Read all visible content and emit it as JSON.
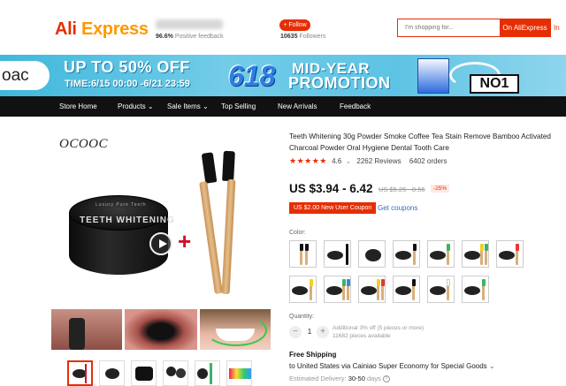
{
  "header": {
    "logo": "AliExpress",
    "feedback_value": "96.6%",
    "feedback_label": "Positive feedback",
    "follow_label": "+ Follow",
    "followers_value": "10635",
    "followers_label": "Followers",
    "search_placeholder": "I'm shopping for...",
    "search_button": "On AliExpress",
    "search_button2": "In"
  },
  "banner": {
    "brand": "oac",
    "headline": "UP TO 50% OFF",
    "time": "TIME:6/15 00:00 -6/21 23:59",
    "big_number": "618",
    "line1": "MID-YEAR",
    "line2": "PROMOTION",
    "badge": "NO1",
    "colors": {
      "background": "#5ec3e4",
      "number": "#2f7fe0"
    }
  },
  "nav": {
    "items": [
      "Store Home",
      "Products",
      "Sale Items",
      "Top Selling",
      "New Arrivals",
      "Feedback"
    ],
    "dropdown_icon": "chevron-down-icon"
  },
  "gallery": {
    "brand_text": "OCOOC",
    "jar_text_1": "Luxury Pure Teeth",
    "jar_text_2": "TEETH WHITENING",
    "plus_sign": "+",
    "play_icon": "play-icon"
  },
  "product": {
    "title": "Teeth Whitening 30g Powder Smoke Coffee Tea Stain Remove Bamboo Activated Charcoal Powder Oral Hygiene Dental Tooth Care",
    "stars": "★★★★★",
    "rating": "4.6",
    "reviews": "2262 Reviews",
    "orders": "6402 orders",
    "price": "US $3.94 - 6.42",
    "old_price": "US $5.25 - 8.56",
    "discount": "-25%",
    "coupon": "US $2.00 New User Coupon",
    "get_coupons": "Get coupons",
    "color_label": "Color:",
    "quantity_label": "Quantity:",
    "quantity_value": "1",
    "qty_minus": "−",
    "qty_plus": "+",
    "qty_note_1": "Additional 3% off (5 pieces or more)",
    "qty_note_2": "11682 pieces available",
    "shipping_title": "Free Shipping",
    "shipping_line": "to United States via Cainiao Super Economy for Special Goods",
    "shipping_chevron": "⌄",
    "delivery_label": "Estimated Delivery:",
    "delivery_value": "30-50",
    "delivery_unit": "days",
    "accent_color": "#e62e04"
  }
}
